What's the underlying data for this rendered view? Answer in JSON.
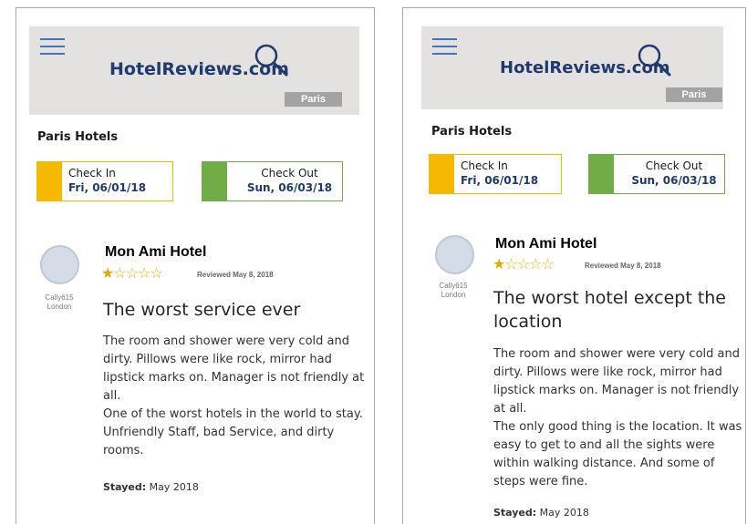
{
  "colors": {
    "header_bg": "#e4e1e1",
    "logo": "#1f3a6e",
    "checkin_accent": "#f5b900",
    "checkout_accent": "#70ad47",
    "star": "#e6a800",
    "badge_bg": "#a3a3a3"
  },
  "screens": [
    {
      "logo": "HotelReviews.com",
      "city_badge": "Paris",
      "section_title": "Paris Hotels",
      "checkin": {
        "label": "Check In",
        "value": "Fri, 06/01/18"
      },
      "checkout": {
        "label": "Check Out",
        "value": "Sun, 06/03/18"
      },
      "review": {
        "hotel": "Mon Ami Hotel",
        "rating": 1,
        "rating_max": 5,
        "reviewed": "Reviewed May 8, 2018",
        "reviewer_name": "Cally615",
        "reviewer_city": "London",
        "title": "The worst service ever",
        "body_1": "The room and shower were very cold and dirty. Pillows were like rock, mirror had lipstick marks on. Manager is not friendly at all.",
        "body_2": "One of the worst hotels in the world to stay. Unfriendly Staff, bad Service, and dirty rooms.",
        "stayed_label": "Stayed:",
        "stayed_value": "May 2018"
      }
    },
    {
      "logo": "HotelReviews.com",
      "city_badge": "Paris",
      "section_title": "Paris Hotels",
      "checkin": {
        "label": "Check In",
        "value": "Fri, 06/01/18"
      },
      "checkout": {
        "label": "Check Out",
        "value": "Sun, 06/03/18"
      },
      "review": {
        "hotel": "Mon Ami Hotel",
        "rating": 1,
        "rating_max": 5,
        "reviewed": "Reviewed May 8, 2018",
        "reviewer_name": "Cally615",
        "reviewer_city": "London",
        "title": "The worst hotel except the location",
        "body_1": "The room and shower were very cold and dirty. Pillows were like rock, mirror had lipstick marks on. Manager is not friendly at all.",
        "body_2": "The only good thing is the location. It was easy to get to and all the sights were within walking distance. And some of steps were fine.",
        "stayed_label": "Stayed:",
        "stayed_value": "May 2018"
      }
    }
  ]
}
